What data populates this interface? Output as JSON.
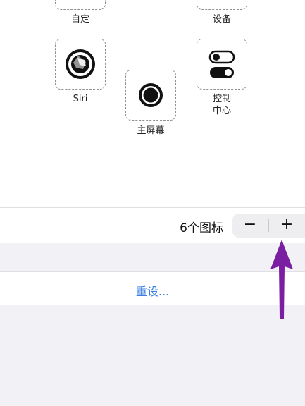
{
  "grid": {
    "labels": {
      "custom": "自定",
      "device": "设备",
      "siri": "Siri",
      "home": "主屏幕",
      "control_center_line1": "控制",
      "control_center_line2": "中心"
    },
    "icons": {
      "siri": "siri-icon",
      "home": "home-button-icon",
      "control_center": "toggle-switch-icon"
    }
  },
  "stepper": {
    "count_label": "6个图标",
    "minus": "−",
    "plus": "+"
  },
  "reset": {
    "label": "重设..."
  },
  "colors": {
    "link": "#3a7fe0",
    "annotation_arrow": "#7b1fa2",
    "slot_border": "#8e8e93"
  }
}
